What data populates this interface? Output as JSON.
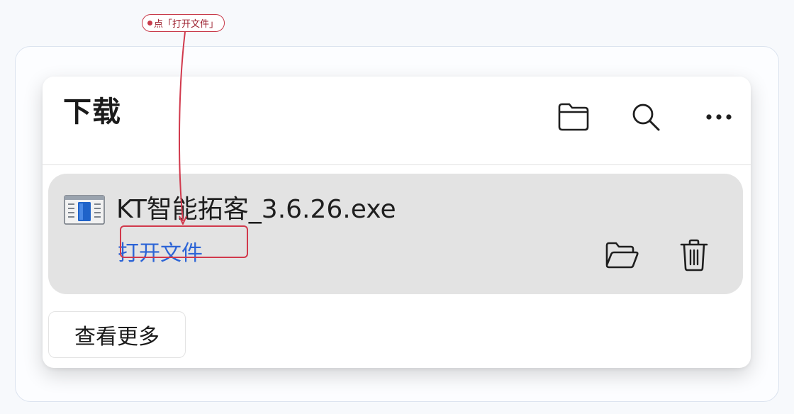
{
  "panel": {
    "title": "下载",
    "header_icons": [
      "folder-icon",
      "search-icon",
      "more-options-icon"
    ]
  },
  "download_item": {
    "file_name": "KT智能拓客_3.6.26.exe",
    "file_icon": "installer-file-icon",
    "open_link": "打开文件",
    "actions": [
      "show-in-folder-icon",
      "delete-icon"
    ]
  },
  "footer": {
    "see_more_label": "查看更多"
  },
  "annotation": {
    "label": "点「打开文件」",
    "color": "#d1394c"
  },
  "colors": {
    "link": "#2c64d6",
    "item_bg": "#e3e3e3",
    "annotation": "#d1394c"
  }
}
